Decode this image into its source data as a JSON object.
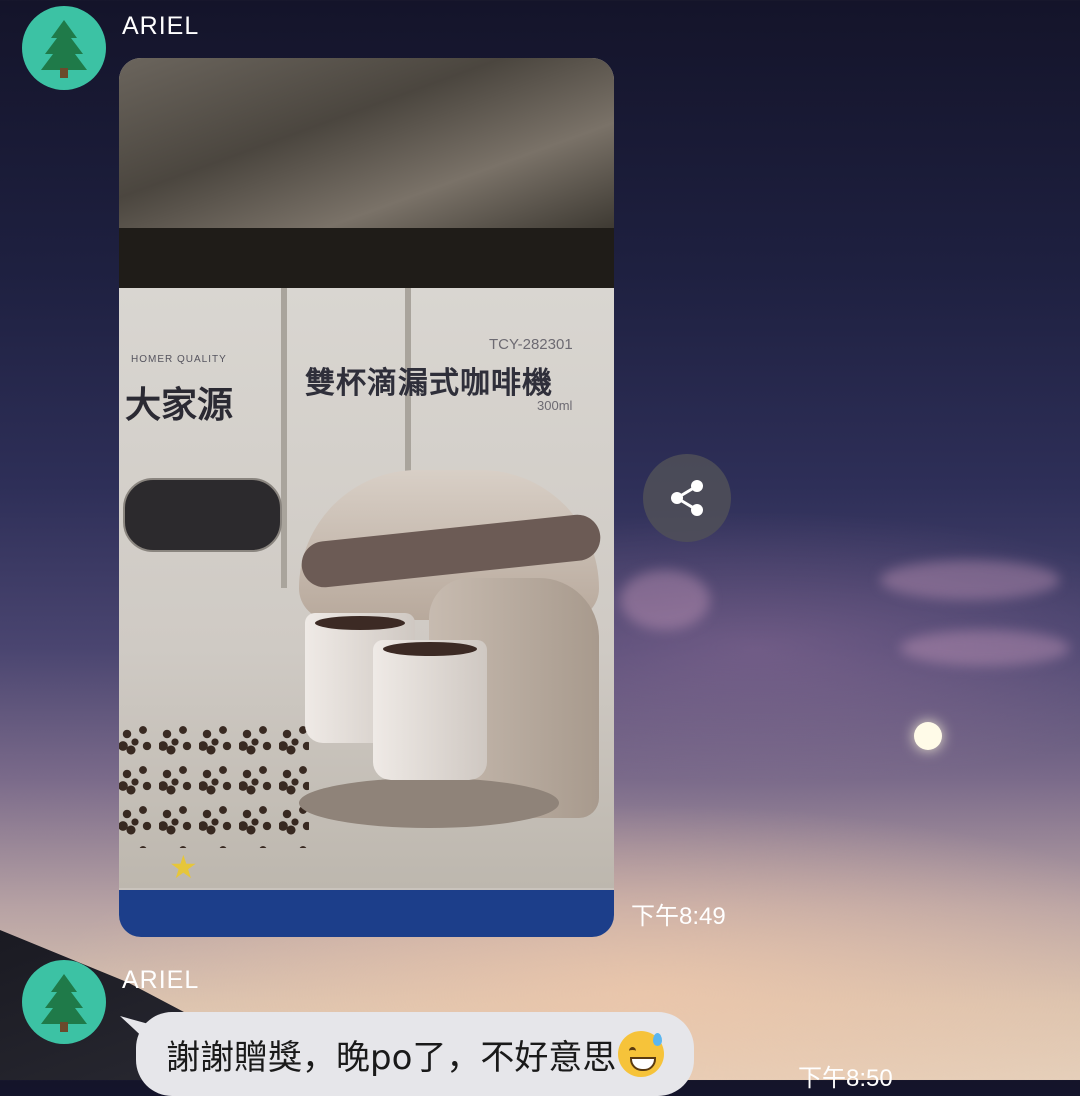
{
  "messages": [
    {
      "sender": "ARIEL",
      "avatar_icon": "tree-icon",
      "type": "image",
      "image": {
        "brand_sub": "HOMER QUALITY",
        "brand": "大家源",
        "model": "TCY-282301",
        "product_name": "雙杯滴漏式咖啡機",
        "volume": "300ml"
      },
      "time": "下午8:49"
    },
    {
      "sender": "ARIEL",
      "avatar_icon": "tree-icon",
      "type": "text",
      "text": "謝謝贈獎，晚po了，不好意思",
      "emoji": "sweat-smile-emoji",
      "time": "下午8:50"
    }
  ],
  "share_button": {
    "icon": "share-icon"
  },
  "colors": {
    "avatar_bg": "#3cc2a4",
    "tree_dark": "#1f7a49",
    "tree_trunk": "#6b4a2c",
    "bubble_bg": "#e6e6ea"
  }
}
